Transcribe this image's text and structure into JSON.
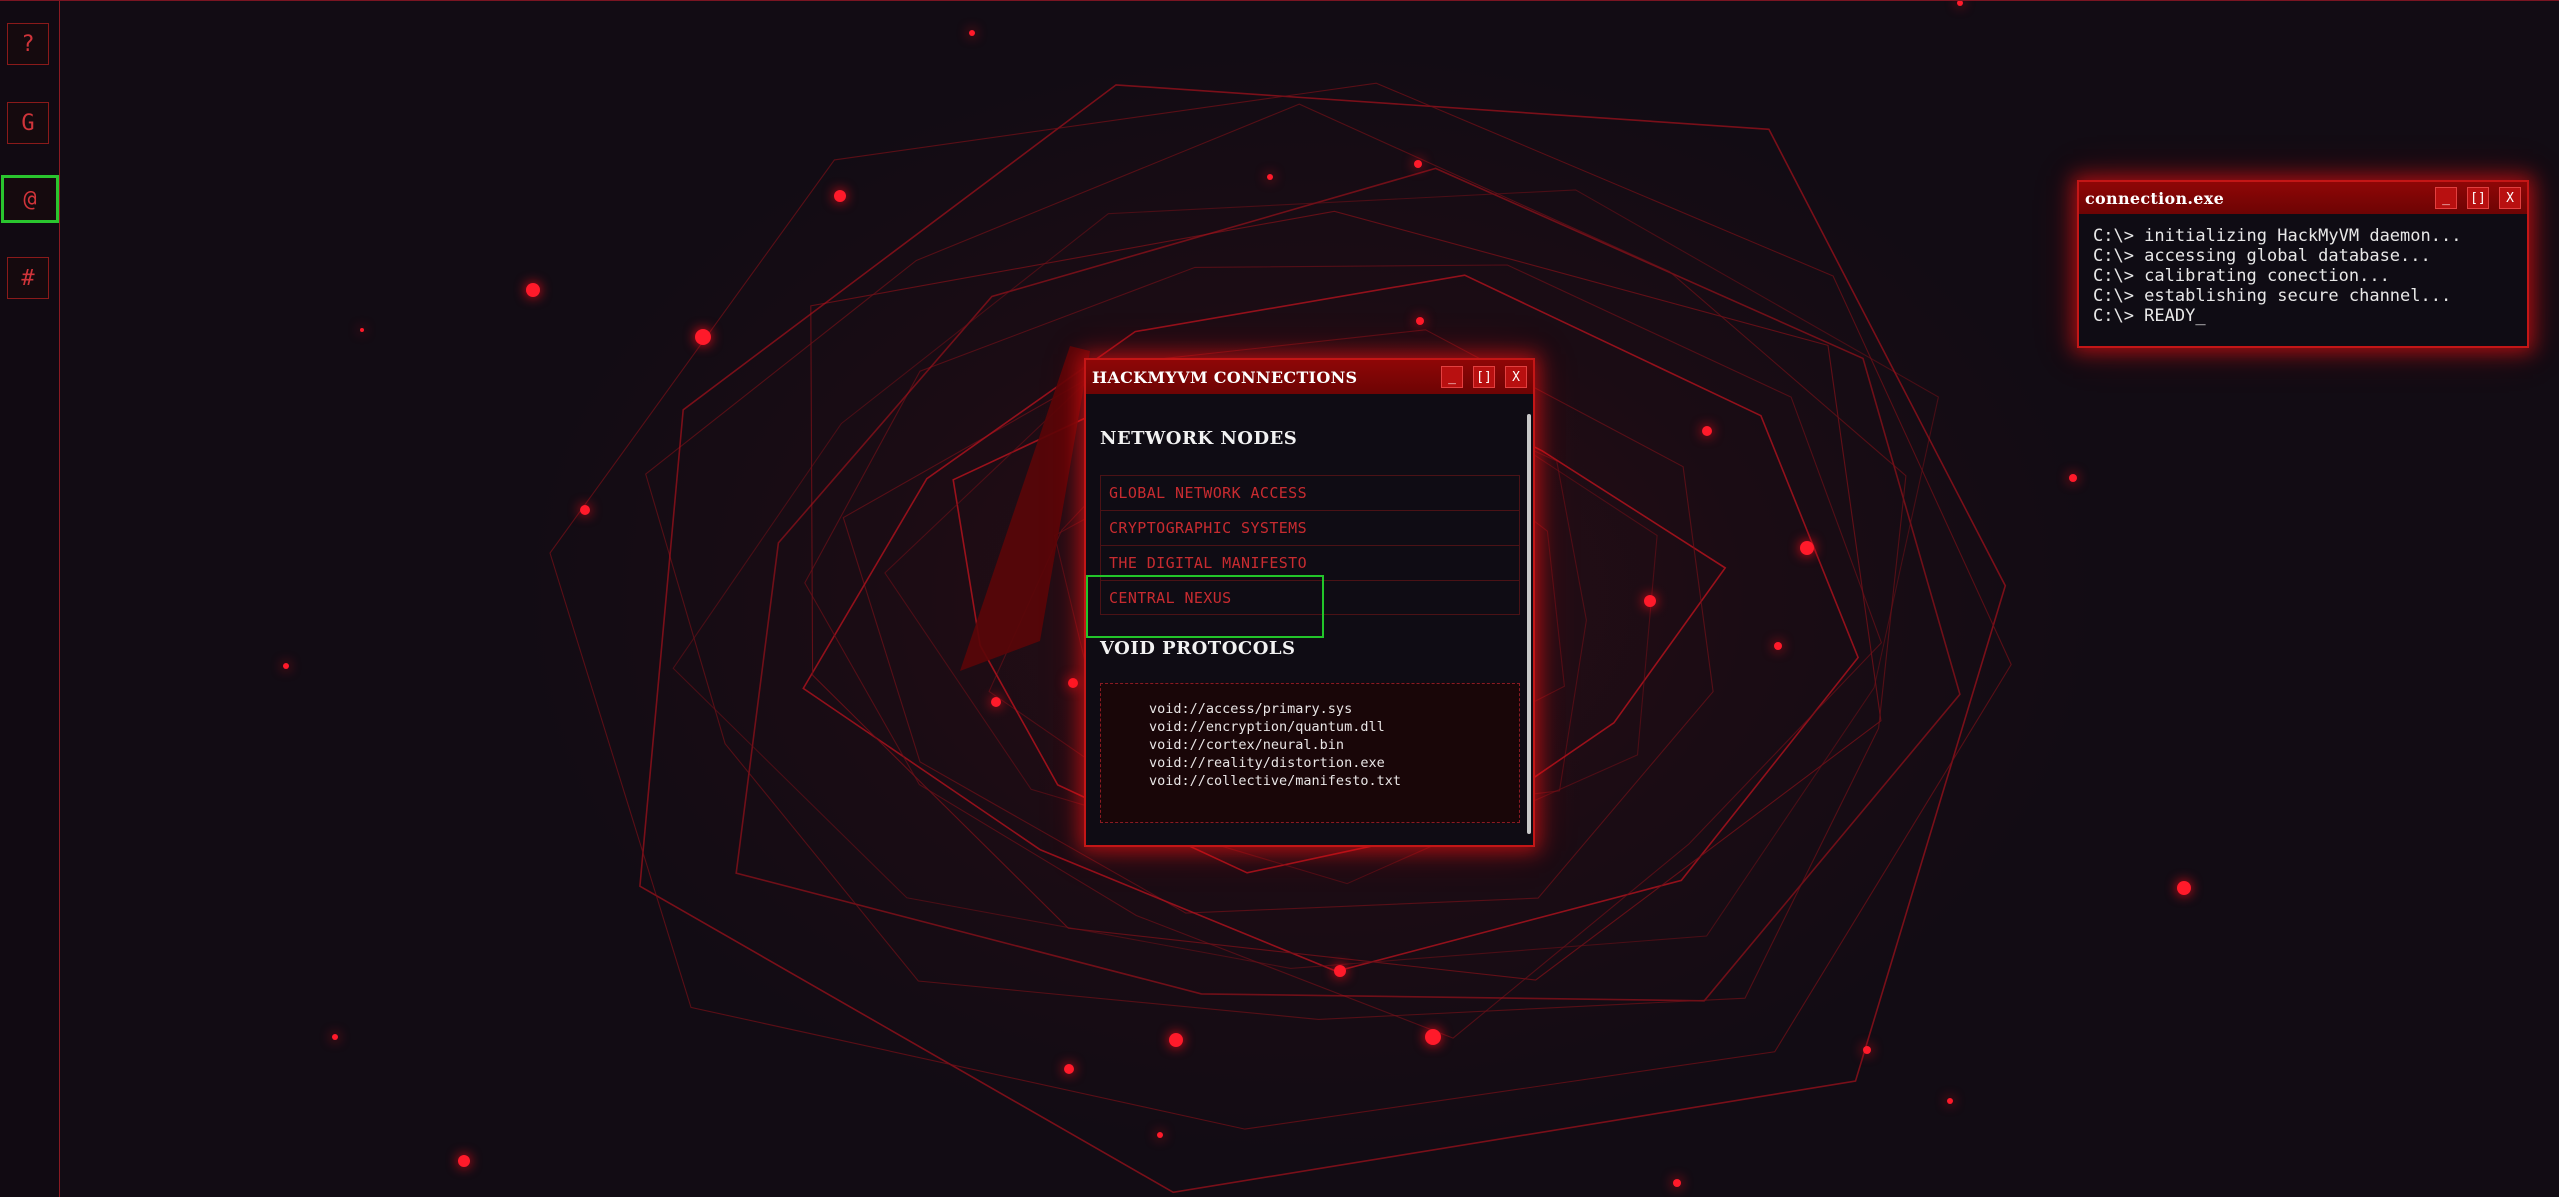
{
  "sidebar": {
    "buttons": [
      {
        "label": "?",
        "active": false
      },
      {
        "label": "G",
        "active": false
      },
      {
        "label": "@",
        "active": true
      },
      {
        "label": "#",
        "active": false
      }
    ]
  },
  "main_window": {
    "title": "HACKMYVM CONNECTIONS",
    "controls": {
      "minimize": "_",
      "maximize": "[]",
      "close": "X"
    },
    "network_nodes": {
      "heading": "NETWORK NODES",
      "items": [
        "GLOBAL NETWORK ACCESS",
        "CRYPTOGRAPHIC SYSTEMS",
        "THE DIGITAL MANIFESTO",
        "CENTRAL NEXUS"
      ]
    },
    "void_protocols": {
      "heading": "VOID PROTOCOLS",
      "lines": [
        "void://access/primary.sys",
        "void://encryption/quantum.dll",
        "void://cortex/neural.bin",
        "void://reality/distortion.exe",
        "void://collective/manifesto.txt"
      ]
    }
  },
  "console_window": {
    "title": "connection.exe",
    "controls": {
      "minimize": "_",
      "maximize": "[]",
      "close": "X"
    },
    "lines": [
      "C:\\> initializing HackMyVM daemon...",
      "C:\\> accessing global database...",
      "C:\\> calibrating conection...",
      "C:\\> establishing secure channel...",
      "C:\\> READY_"
    ]
  },
  "colors": {
    "accent": "#c41616",
    "highlight": "#22c52a",
    "background": "#130d14"
  }
}
